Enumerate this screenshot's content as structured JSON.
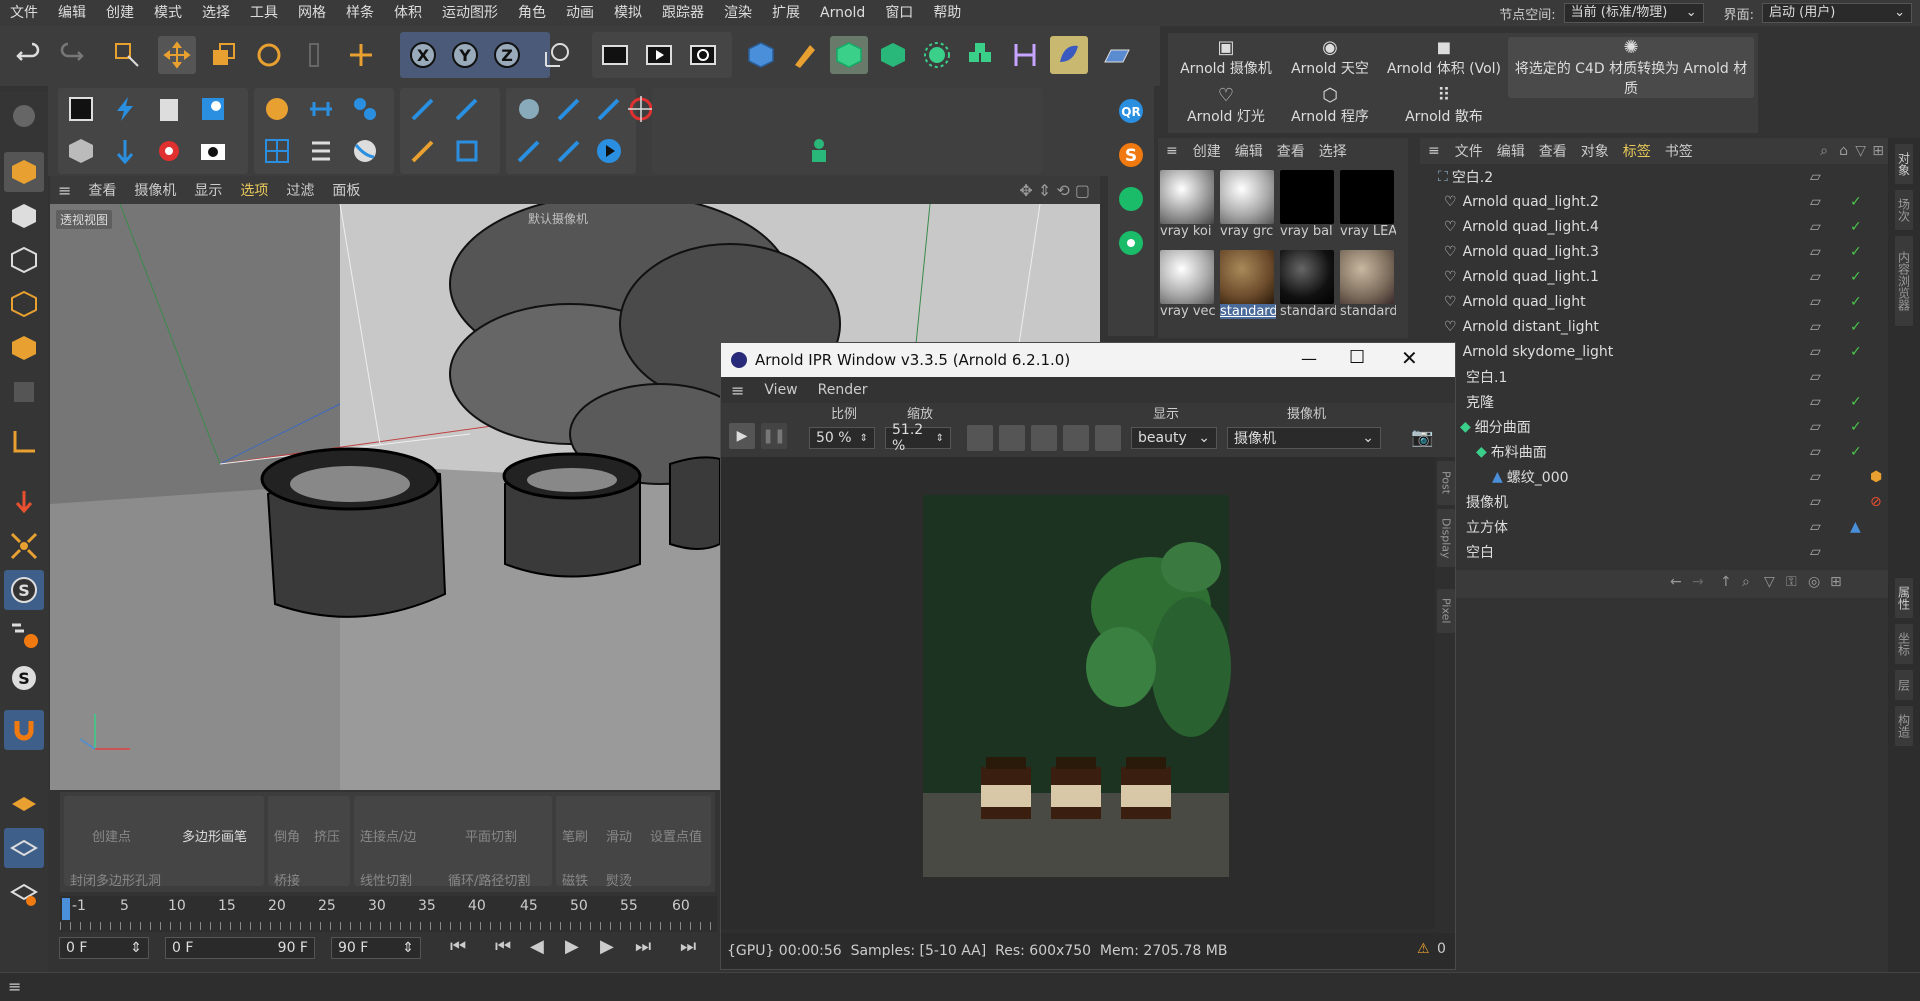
{
  "menu": {
    "items": [
      "文件",
      "编辑",
      "创建",
      "模式",
      "选择",
      "工具",
      "网格",
      "样条",
      "体积",
      "运动图形",
      "角色",
      "动画",
      "模拟",
      "跟踪器",
      "渲染",
      "扩展",
      "Arnold",
      "窗口",
      "帮助"
    ],
    "node_space_label": "节点空间:",
    "node_space_value": "当前 (标准/物理)",
    "layout_label": "界面:",
    "layout_value": "启动 (用户)"
  },
  "viewport": {
    "menu": [
      "查看",
      "摄像机",
      "显示",
      "选项",
      "过滤",
      "面板"
    ],
    "label": "透视视图",
    "camera_label": "默认摄像机"
  },
  "modeling": {
    "buttons": [
      "创建点",
      "多边形画笔",
      "倒角",
      "挤压",
      "连接点/边",
      "平面切割",
      "笔刷",
      "滑动",
      "设置点值",
      "封闭多边形孔洞",
      "桥接",
      "线性切割",
      "循环/路径切割",
      "磁铁",
      "熨烫"
    ]
  },
  "timeline": {
    "ticks": [
      "-1",
      "5",
      "10",
      "15",
      "20",
      "25",
      "30",
      "35",
      "40",
      "45",
      "50",
      "55",
      "60"
    ],
    "start": "0 F",
    "current_a": "0 F",
    "end_a": "90 F",
    "end_b": "90 F"
  },
  "arnold": {
    "buttons": [
      "Arnold 摄像机",
      "Arnold 天空",
      "Arnold 体积 (Vol)",
      "将选定的 C4D 材质转换为 Arnold 材质",
      "Arnold 灯光",
      "Arnold 程序",
      "Arnold 散布"
    ]
  },
  "materials": {
    "menu": [
      "创建",
      "编辑",
      "查看",
      "选择"
    ],
    "items": [
      "vray koi",
      "vray grc",
      "vray bal",
      "vray LEA",
      "vray vec",
      "standard",
      "standard",
      "standard"
    ]
  },
  "objects": {
    "menu": [
      "文件",
      "编辑",
      "查看",
      "对象",
      "标签",
      "书签"
    ],
    "rows": [
      "空白.2",
      "Arnold quad_light.2",
      "Arnold quad_light.4",
      "Arnold quad_light.3",
      "Arnold quad_light.1",
      "Arnold quad_light",
      "Arnold distant_light",
      "Arnold skydome_light",
      "空白.1",
      "克隆",
      "细分曲面",
      "布料曲面",
      "螺纹_000",
      "摄像机",
      "立方体",
      "空白"
    ]
  },
  "right_tabs": [
    "对象",
    "场次",
    "内容浏览器",
    "属性",
    "坐标",
    "层",
    "构造"
  ],
  "ipr": {
    "title": "Arnold IPR Window v3.3.5 (Arnold 6.2.1.0)",
    "menu": [
      "View",
      "Render"
    ],
    "ratio_label": "比例",
    "ratio_value": "50 %",
    "zoom_label": "缩放",
    "zoom_value": "51.2 %",
    "display_label": "显示",
    "display_value": "beauty",
    "camera_label": "摄像机",
    "camera_value": "摄像机",
    "side_tabs": [
      "Post",
      "Display",
      "Pixel"
    ],
    "status": "{GPU} 00:00:56  Samples: [5-10 AA]  Res: 600x750  Mem: 2705.78 MB",
    "warnings": "0"
  },
  "colors": {
    "accent_blue": "#4a8fd9",
    "accent_yellow": "#e6b200",
    "check_green": "#49c449"
  }
}
